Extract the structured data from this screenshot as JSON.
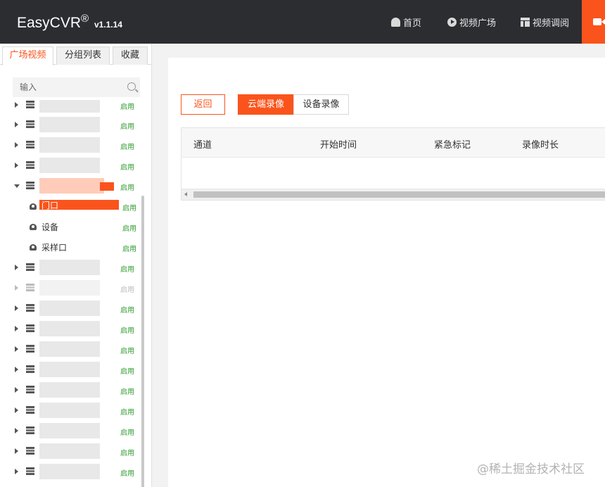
{
  "header": {
    "brand": "EasyCVR",
    "brand_reg": "®",
    "version": "v1.1.14",
    "nav": {
      "home": "首页",
      "video_square": "视频广场",
      "video_tune": "视频调阅"
    },
    "colors": {
      "background": "#2b2d31",
      "accent": "#fa541c"
    }
  },
  "sidebar": {
    "tabs": [
      {
        "label": "广场视频",
        "active": true
      },
      {
        "label": "分组列表",
        "active": false
      },
      {
        "label": "收藏",
        "active": false
      }
    ],
    "search": {
      "placeholder": "输入"
    },
    "tree": [
      {
        "type": "device",
        "status": "启用"
      },
      {
        "type": "device",
        "status": "启用"
      },
      {
        "type": "device",
        "status": "启用"
      },
      {
        "type": "device",
        "status": "启用"
      },
      {
        "type": "device",
        "expanded": true,
        "status": "启用"
      },
      {
        "type": "channel",
        "label": "门口",
        "selected": true,
        "status": "启用"
      },
      {
        "type": "channel",
        "label": "设备",
        "status": "启用"
      },
      {
        "type": "channel",
        "label": "采样口",
        "status": "启用"
      },
      {
        "type": "device",
        "status": "启用"
      },
      {
        "type": "device",
        "status": "启用",
        "disabled": true
      },
      {
        "type": "device",
        "status": "启用"
      },
      {
        "type": "device",
        "status": "启用"
      },
      {
        "type": "device",
        "status": "启用"
      },
      {
        "type": "device",
        "status": "启用"
      },
      {
        "type": "device",
        "status": "启用"
      },
      {
        "type": "device",
        "status": "启用"
      },
      {
        "type": "device",
        "status": "启用"
      },
      {
        "type": "device",
        "status": "启用"
      },
      {
        "type": "device",
        "status": "启用"
      }
    ]
  },
  "main": {
    "buttons": {
      "back": "返回",
      "cloud_record": "云端录像",
      "device_record": "设备录像"
    },
    "table": {
      "columns": [
        "通道",
        "开始时间",
        "紧急标记",
        "录像时长"
      ],
      "rows": []
    }
  },
  "watermark": "@稀土掘金技术社区"
}
